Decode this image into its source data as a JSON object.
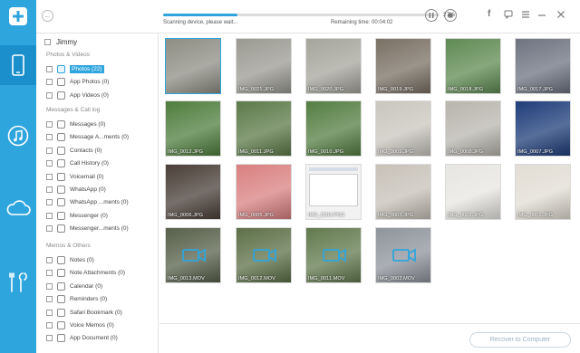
{
  "top": {
    "status_text": "Scanning device, please wait...",
    "remaining_text": "Remaining time: 00:04:02",
    "progress_percent": 27,
    "progress_label": "27%",
    "icons": [
      "back-arrow-icon",
      "pause-icon",
      "stop-icon",
      "facebook-icon",
      "feedback-icon",
      "menu-icon",
      "close-icon"
    ]
  },
  "rail": {
    "items": [
      {
        "name": "device",
        "icon": "smartphone-icon",
        "active": true
      },
      {
        "name": "itunes",
        "icon": "music-note-icon",
        "active": false
      },
      {
        "name": "icloud",
        "icon": "cloud-icon",
        "active": false
      },
      {
        "name": "toolkit",
        "icon": "tools-icon",
        "active": false
      }
    ]
  },
  "sidebar": {
    "owner": "Jimmy",
    "sections": [
      {
        "title": "Photos & Videos",
        "items": [
          {
            "label": "Photos (22)",
            "selected": true
          },
          {
            "label": "App Photos (0)"
          },
          {
            "label": "App Videos (0)"
          }
        ]
      },
      {
        "title": "Messages & Call log",
        "items": [
          {
            "label": "Messages (0)"
          },
          {
            "label": "Message A...ments (0)"
          },
          {
            "label": "Contacts (0)"
          },
          {
            "label": "Call History (0)"
          },
          {
            "label": "Voicemail (0)"
          },
          {
            "label": "WhatsApp (0)"
          },
          {
            "label": "WhatsApp ...ments (0)"
          },
          {
            "label": "Messenger (0)"
          },
          {
            "label": "Messenger...ments (0)"
          }
        ]
      },
      {
        "title": "Memos & Others",
        "items": [
          {
            "label": "Notes (0)"
          },
          {
            "label": "Note Attachments (0)"
          },
          {
            "label": "Calendar (0)"
          },
          {
            "label": "Reminders (0)"
          },
          {
            "label": "Safari Bookmark (0)"
          },
          {
            "label": "Voice Memos (0)"
          },
          {
            "label": "App Document (0)"
          }
        ]
      }
    ]
  },
  "gallery": {
    "items": [
      {
        "caption": "",
        "kind": "photo",
        "palette": "#8e8e84"
      },
      {
        "caption": "IMG_0021.JPG",
        "kind": "photo",
        "palette": "#9b9a92"
      },
      {
        "caption": "IMG_0020.JPG",
        "kind": "photo",
        "palette": "#a5a59c"
      },
      {
        "caption": "IMG_0019.JPG",
        "kind": "photo",
        "palette": "#7a7064"
      },
      {
        "caption": "IMG_0018.JPG",
        "kind": "photo",
        "palette": "#5f8a52"
      },
      {
        "caption": "IMG_0017.JPG",
        "kind": "photo",
        "palette": "#6d7380"
      },
      {
        "caption": "IMG_0012.JPG",
        "kind": "photo",
        "palette": "#4f7d3d"
      },
      {
        "caption": "IMG_0011.JPG",
        "kind": "photo",
        "palette": "#5c7a48"
      },
      {
        "caption": "IMG_0010.JPG",
        "kind": "photo",
        "palette": "#547e42"
      },
      {
        "caption": "IMG_0009.JPG",
        "kind": "photo",
        "palette": "#c9c6be"
      },
      {
        "caption": "IMG_0008.JPG",
        "kind": "photo",
        "palette": "#b8b5ad"
      },
      {
        "caption": "IMG_0007.JPG",
        "kind": "photo",
        "palette": "#1f3d7a"
      },
      {
        "caption": "IMG_0006.JPG",
        "kind": "photo",
        "palette": "#4a3f38"
      },
      {
        "caption": "IMG_0005.JPG",
        "kind": "photo",
        "palette": "#d98080"
      },
      {
        "caption": "IMG_0004.PNG",
        "kind": "screenshot",
        "palette": "#f2f2f2"
      },
      {
        "caption": "IMG_0003.JPG",
        "kind": "photo",
        "palette": "#c7c1b8"
      },
      {
        "caption": "IMG_0002.JPG",
        "kind": "photo",
        "palette": "#e8e6e2"
      },
      {
        "caption": "IMG_0001.JPG",
        "kind": "photo",
        "palette": "#e2ddd4"
      },
      {
        "caption": "IMG_0013.MOV",
        "kind": "video",
        "palette": "#57604a"
      },
      {
        "caption": "IMG_0012.MOV",
        "kind": "video",
        "palette": "#5d7048"
      },
      {
        "caption": "IMG_0011.MOV",
        "kind": "video",
        "palette": "#627a4e"
      },
      {
        "caption": "IMG_0003.MOV",
        "kind": "video",
        "palette": "#8f949c"
      }
    ]
  },
  "bottom": {
    "recover_label": "Recover to Computer"
  },
  "colors": {
    "accent": "#2fa5dd",
    "rail_active": "#1b8fcb"
  }
}
